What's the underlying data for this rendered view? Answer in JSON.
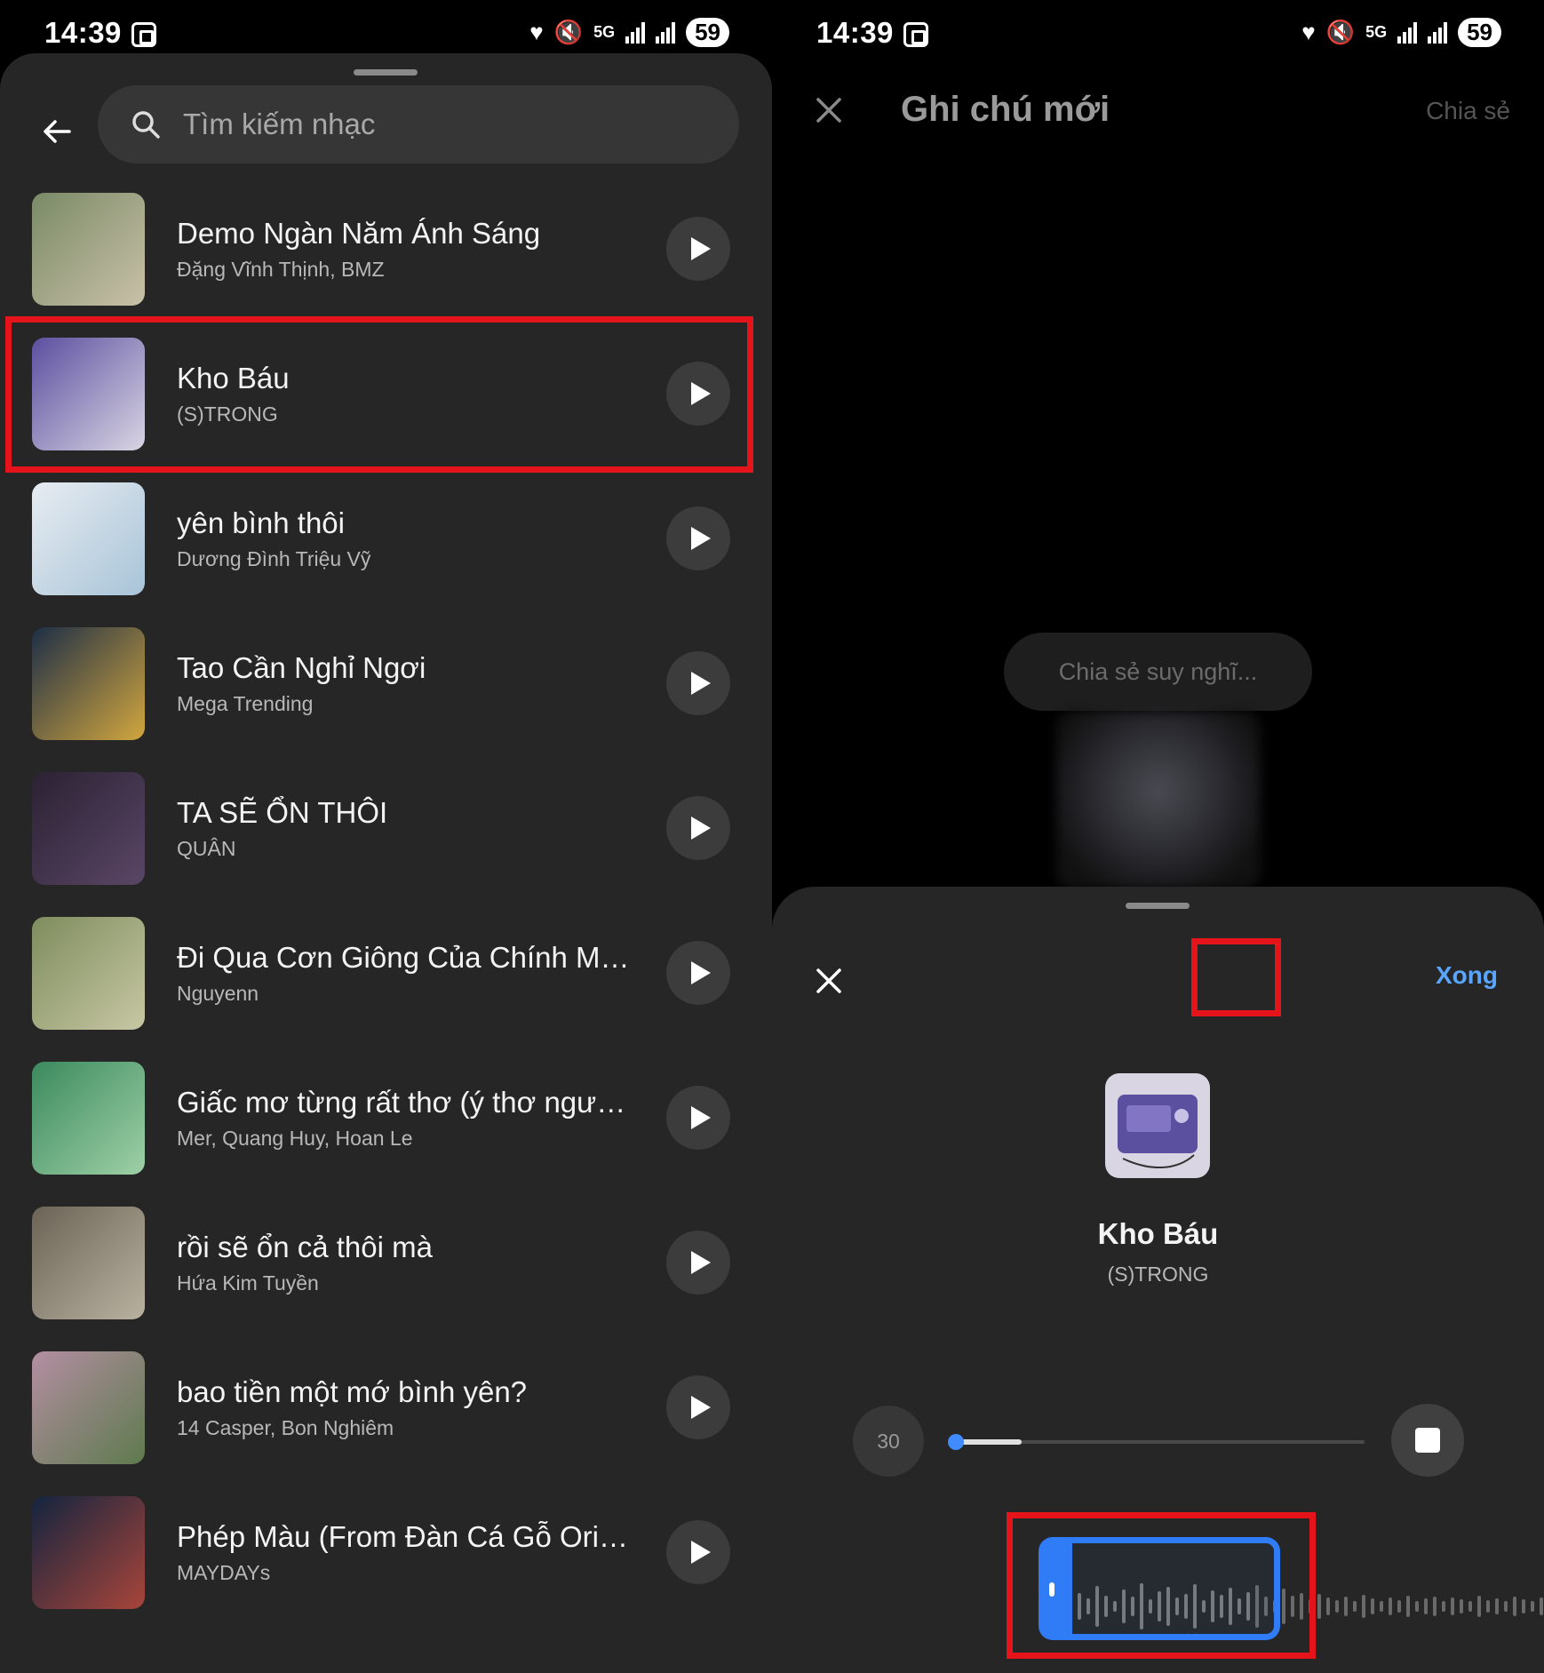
{
  "status_bar": {
    "time": "14:39",
    "network": "5G",
    "battery": "59"
  },
  "search": {
    "placeholder": "Tìm kiếm nhạc"
  },
  "songs": [
    {
      "title": "Demo Ngàn Năm Ánh Sáng",
      "artist": "Đặng Vĩnh Thịnh, BMZ",
      "cover_colors": [
        "#7a8a66",
        "#c9c1a8"
      ]
    },
    {
      "title": "Kho Báu",
      "artist": "(S)TRONG",
      "cover_colors": [
        "#5b4fa0",
        "#d9d5e3"
      ]
    },
    {
      "title": "yên bình thôi",
      "artist": "Dương Đình Triệu Vỹ",
      "cover_colors": [
        "#e7ecf1",
        "#a8c4d8"
      ]
    },
    {
      "title": "Tao Cần Nghỉ Ngơi",
      "artist": "Mega Trending",
      "cover_colors": [
        "#1d2e46",
        "#d2a63e"
      ]
    },
    {
      "title": "TA SẼ ỔN THÔI",
      "artist": "QUÂN",
      "cover_colors": [
        "#2b2233",
        "#5a4666"
      ]
    },
    {
      "title": "Đi Qua Cơn Giông Của Chính Mình",
      "artist": "Nguyenn",
      "cover_colors": [
        "#7e8d5d",
        "#c7c7a4"
      ]
    },
    {
      "title": "Giấc mơ từng rất thơ (ý thơ ngườ...",
      "artist": "Mer, Quang Huy, Hoan Le",
      "cover_colors": [
        "#3b8a5e",
        "#9fd0a6"
      ]
    },
    {
      "title": "rồi sẽ ổn cả thôi mà",
      "artist": "Hứa Kim Tuyền",
      "cover_colors": [
        "#6b6456",
        "#b9b1a0"
      ]
    },
    {
      "title": "bao tiền một mớ bình yên?",
      "artist": "14 Casper, Bon Nghiêm",
      "cover_colors": [
        "#b38ea2",
        "#5e7a4e"
      ]
    },
    {
      "title": "Phép Màu (From Đàn Cá Gỗ Orig...",
      "artist": "MAYDAYs",
      "cover_colors": [
        "#13243f",
        "#a8453a"
      ]
    }
  ],
  "right": {
    "header_title": "Ghi chú mới",
    "share_label": "Chia sẻ",
    "note_placeholder": "Chia sẻ suy nghĩ...",
    "done_label": "Xong",
    "selected_title": "Kho Báu",
    "selected_artist": "(S)TRONG",
    "duration": "30",
    "progress_fraction": 0.16,
    "accent": "#2f7cf6",
    "highlight": "#e5141b"
  }
}
